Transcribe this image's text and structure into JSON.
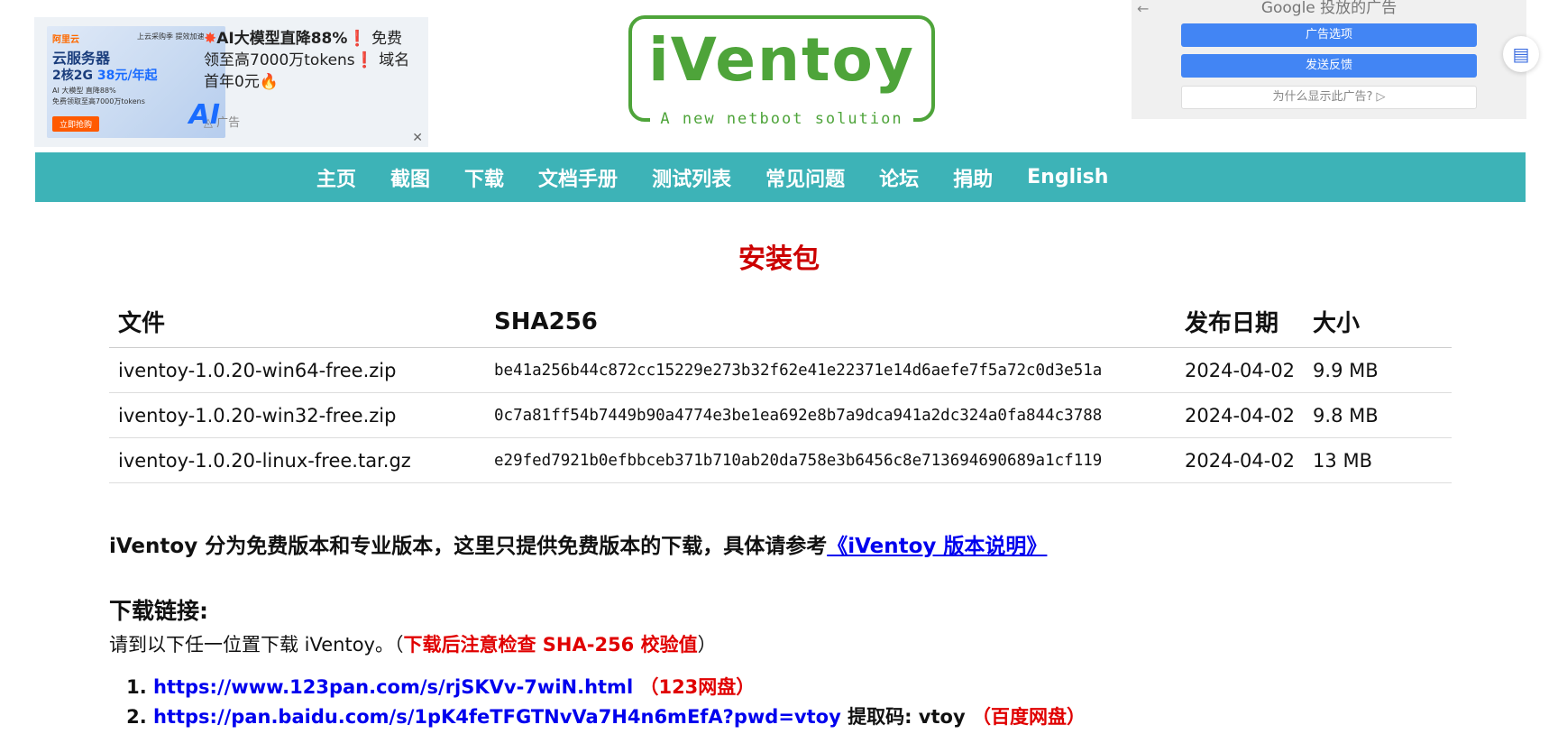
{
  "ad_left": {
    "thumb_logo": "阿里云",
    "thumb_small": "上云采购季 提效加速",
    "thumb_line1": "云服务器",
    "thumb_line2_a": "2核2G ",
    "thumb_line2_b": "38元/年起",
    "thumb_line3": "AI 大模型 直降88%",
    "thumb_line4": "免费领取至高7000万tokens",
    "thumb_buy": "立即抢购",
    "thumb_ai": "AI",
    "copy_star": "✸",
    "copy_bold": "AI大模型直降88%",
    "copy_mark1": "❗",
    "copy_rest1": " 免费领至高7000万tokens",
    "copy_mark2": "❗",
    "copy_rest2": " 域名首年0元",
    "copy_fire": "🔥",
    "ad_label": "广告",
    "close": "✕"
  },
  "brand": {
    "name": "iVentoy",
    "tagline": "A new netboot solution"
  },
  "ad_right": {
    "back": "←",
    "google_label": "Google 投放的广告",
    "btn_options": "广告选项",
    "btn_feedback": "发送反馈",
    "btn_why": "为什么显示此广告? ▷"
  },
  "side_icon": "▤",
  "nav": {
    "items": [
      "主页",
      "截图",
      "下载",
      "文档手册",
      "测试列表",
      "常见问题",
      "论坛",
      "捐助",
      "English"
    ]
  },
  "page_title": "安装包",
  "table": {
    "headers": [
      "文件",
      "SHA256",
      "发布日期",
      "大小"
    ],
    "rows": [
      [
        "iventoy-1.0.20-win64-free.zip",
        "be41a256b44c872cc15229e273b32f62e41e22371e14d6aefe7f5a72c0d3e51a",
        "2024-04-02",
        "9.9 MB"
      ],
      [
        "iventoy-1.0.20-win32-free.zip",
        "0c7a81ff54b7449b90a4774e3be1ea692e8b7a9dca941a2dc324a0fa844c3788",
        "2024-04-02",
        "9.8 MB"
      ],
      [
        "iventoy-1.0.20-linux-free.tar.gz",
        "e29fed7921b0efbbceb371b710ab20da758e3b6456c8e713694690689a1cf119",
        "2024-04-02",
        "13 MB"
      ]
    ]
  },
  "note": {
    "text": "iVentoy 分为免费版本和专业版本，这里只提供免费版本的下载，具体请参考",
    "link": "《iVentoy 版本说明》"
  },
  "download": {
    "heading": "下载链接:",
    "intro": "请到以下任一位置下载 iVentoy。（",
    "intro_warn": "下载后注意检查 SHA-256 校验值",
    "intro_end": "）",
    "links": [
      {
        "url": "https://www.123pan.com/s/rjSKVv-7wiN.html",
        "extra": "",
        "label": "（123网盘）"
      },
      {
        "url": "https://pan.baidu.com/s/1pK4feTFGTNvVa7H4n6mEfA?pwd=vtoy",
        "extra": " 提取码: vtoy",
        "label": "（百度网盘）"
      }
    ]
  }
}
